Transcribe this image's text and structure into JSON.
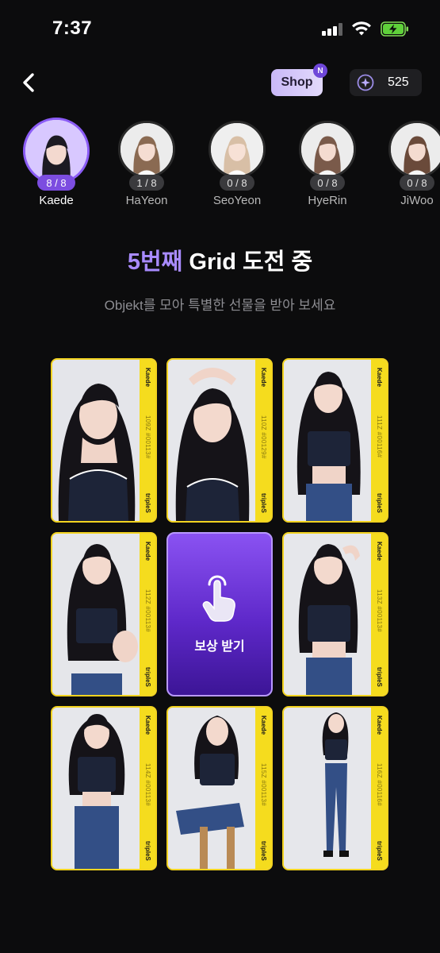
{
  "status": {
    "time": "7:37"
  },
  "nav": {
    "shop_label": "Shop",
    "shop_badge": "N",
    "coin_count": "525"
  },
  "members": [
    {
      "name": "Kaede",
      "count": "8 / 8",
      "selected": true
    },
    {
      "name": "HaYeon",
      "count": "1 / 8",
      "selected": false
    },
    {
      "name": "SeoYeon",
      "count": "0 / 8",
      "selected": false
    },
    {
      "name": "HyeRin",
      "count": "0 / 8",
      "selected": false
    },
    {
      "name": "JiWoo",
      "count": "0 / 8",
      "selected": false
    }
  ],
  "heading": {
    "accent": "5번째",
    "rest": " Grid 도전 중",
    "subtitle": "Objekt를 모아 특별한 선물을 받아 보세요"
  },
  "grid": {
    "cards": [
      {
        "member": "Kaede",
        "serial": "109Z #00113#",
        "brand": "tripleS"
      },
      {
        "member": "Kaede",
        "serial": "110Z #00129#",
        "brand": "tripleS"
      },
      {
        "member": "Kaede",
        "serial": "111Z #00116#",
        "brand": "tripleS"
      },
      {
        "member": "Kaede",
        "serial": "112Z #00113#",
        "brand": "tripleS"
      },
      {
        "member": "Kaede",
        "serial": "113Z #00113#",
        "brand": "tripleS"
      },
      {
        "member": "Kaede",
        "serial": "114Z #00113#",
        "brand": "tripleS"
      },
      {
        "member": "Kaede",
        "serial": "115Z #00113#",
        "brand": "tripleS"
      },
      {
        "member": "Kaede",
        "serial": "116Z #00116#",
        "brand": "tripleS"
      }
    ],
    "reward_label": "보상 받기"
  },
  "colors": {
    "accent": "#8b5cf6",
    "card_border": "#f2d320",
    "background": "#0c0c0d"
  }
}
